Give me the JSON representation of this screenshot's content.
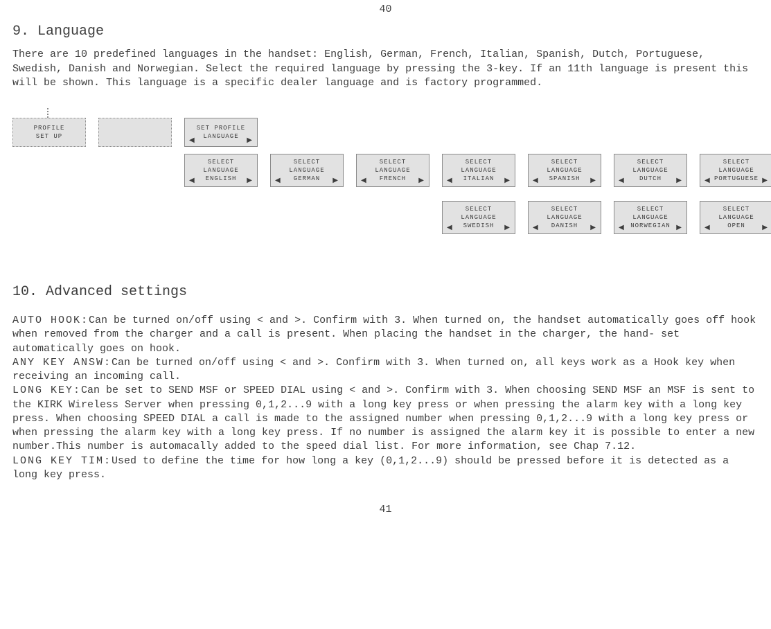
{
  "page_top": "40",
  "page_bottom": "41",
  "section9": {
    "heading": "9. Language",
    "paragraph": "There are 10 predefined languages in the handset: English, German, French, Italian, Spanish, Dutch, Portuguese, Swedish, Danish and Norwegian. Select the required language by pressing the 3-key. If an 11th language is present this will be shown. This language is a specific dealer language and is factory programmed."
  },
  "diagram": {
    "profile_setup": {
      "line1": "PROFILE",
      "line2": "SET UP"
    },
    "set_profile_language": {
      "line1": "SET PROFILE",
      "line2": "LANGUAGE"
    },
    "r1": [
      {
        "l1": "SELECT",
        "l2": "LANGUAGE",
        "l3": "ENGLISH"
      },
      {
        "l1": "SELECT",
        "l2": "LANGUAGE",
        "l3": "GERMAN"
      },
      {
        "l1": "SELECT",
        "l2": "LANGUAGE",
        "l3": "FRENCH"
      },
      {
        "l1": "SELECT",
        "l2": "LANGUAGE",
        "l3": "ITALIAN"
      },
      {
        "l1": "SELECT",
        "l2": "LANGUAGE",
        "l3": "SPANISH"
      },
      {
        "l1": "SELECT",
        "l2": "LANGUAGE",
        "l3": "DUTCH"
      },
      {
        "l1": "SELECT",
        "l2": "LANGUAGE",
        "l3": "PORTUGUESE"
      }
    ],
    "r2": [
      {
        "l1": "SELECT",
        "l2": "LANGUAGE",
        "l3": "SWEDISH"
      },
      {
        "l1": "SELECT",
        "l2": "LANGUAGE",
        "l3": "DANISH"
      },
      {
        "l1": "SELECT",
        "l2": "LANGUAGE",
        "l3": "NORWEGIAN"
      },
      {
        "l1": "SELECT",
        "l2": "LANGUAGE",
        "l3": "OPEN"
      }
    ],
    "arrow_left": "◀",
    "arrow_right": "▶"
  },
  "section10": {
    "heading": "10. Advanced settings",
    "auto_hook_label": "AUTO HOOK:",
    "auto_hook": "Can be turned on/off using < and >. Confirm with 3. When turned on, the handset automatically goes off hook when removed from the charger and a call is present. When placing the handset in the charger, the hand- set automatically goes on hook.",
    "any_key_label": "ANY KEY ANSW:",
    "any_key": "Can be turned on/off using < and >. Confirm with 3. When turned on, all keys work as a Hook key when receiving an incoming call.",
    "long_key_label": "LONG KEY:",
    "long_key": "Can be set to  SEND MSF  or  SPEED DIAL  using < and >. Confirm with 3. When choosing  SEND MSF  an MSF is sent to the KIRK Wireless Server when pressing 0,1,2...9 with a long key press or when pressing the alarm key with a long key press. When choosing  SPEED DIAL  a call is made to the assigned number when pressing 0,1,2...9 with a long key press or when pressing the alarm key with a long key press. If no number is assigned the alarm key it is possible to enter a new number.This number is automacally added to the speed dial list. For more information, see Chap 7.12.",
    "long_key_tim_label": "LONG KEY TIM:",
    "long_key_tim": "Used to define the time for how long a key (0,1,2...9) should be pressed before it is detected as a long key press."
  }
}
